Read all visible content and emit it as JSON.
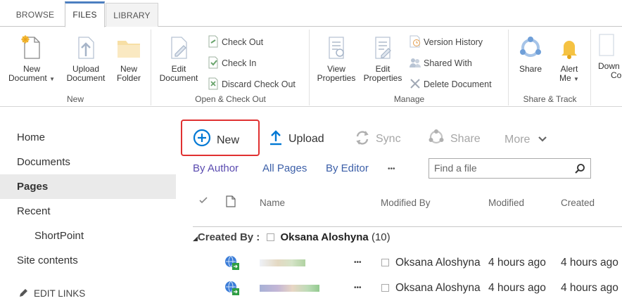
{
  "tabs": [
    "BROWSE",
    "FILES",
    "LIBRARY"
  ],
  "ribbon": {
    "groups": {
      "new": {
        "label": "New",
        "new_document": [
          "New",
          "Document"
        ],
        "upload_document": [
          "Upload",
          "Document"
        ],
        "new_folder": [
          "New",
          "Folder"
        ]
      },
      "open_checkout": {
        "label": "Open & Check Out",
        "edit_document": [
          "Edit",
          "Document"
        ],
        "check_out": "Check Out",
        "check_in": "Check In",
        "discard_check_out": "Discard Check Out"
      },
      "manage": {
        "label": "Manage",
        "view_properties": [
          "View",
          "Properties"
        ],
        "edit_properties": [
          "Edit",
          "Properties"
        ],
        "version_history": "Version History",
        "shared_with": "Shared With",
        "delete_document": "Delete Document"
      },
      "share_track": {
        "label": "Share & Track",
        "share": "Share",
        "alert_me": [
          "Alert",
          "Me"
        ]
      },
      "partial": [
        "Down",
        "Co"
      ]
    }
  },
  "nav": {
    "items": [
      "Home",
      "Documents",
      "Pages",
      "Recent",
      "ShortPoint",
      "Site contents"
    ],
    "edit_links": "EDIT LINKS"
  },
  "commands": {
    "new": "New",
    "upload": "Upload",
    "sync": "Sync",
    "share": "Share",
    "more": "More"
  },
  "views": {
    "by_author": "By Author",
    "all_pages": "All Pages",
    "by_editor": "By Editor",
    "ellipsis": "•••",
    "search_placeholder": "Find a file"
  },
  "table": {
    "headers": [
      "Name",
      "Modified By",
      "Modified",
      "Created"
    ],
    "group_label": "Created By :",
    "group_name": "Oksana Aloshyna",
    "group_count": "(10)",
    "rows": [
      {
        "ellipsis": "•••",
        "modified_by": "Oksana Aloshyna",
        "modified": "4 hours ago",
        "created": "4 hours ago"
      },
      {
        "ellipsis": "•••",
        "modified_by": "Oksana Aloshyna",
        "modified": "4 hours ago",
        "created": "4 hours ago"
      }
    ]
  },
  "colors": {
    "accent_blue": "#0078d4",
    "highlight_red": "#e03131",
    "view_link": "#3c5fa8",
    "icon_gray": "#a6b4c8"
  }
}
